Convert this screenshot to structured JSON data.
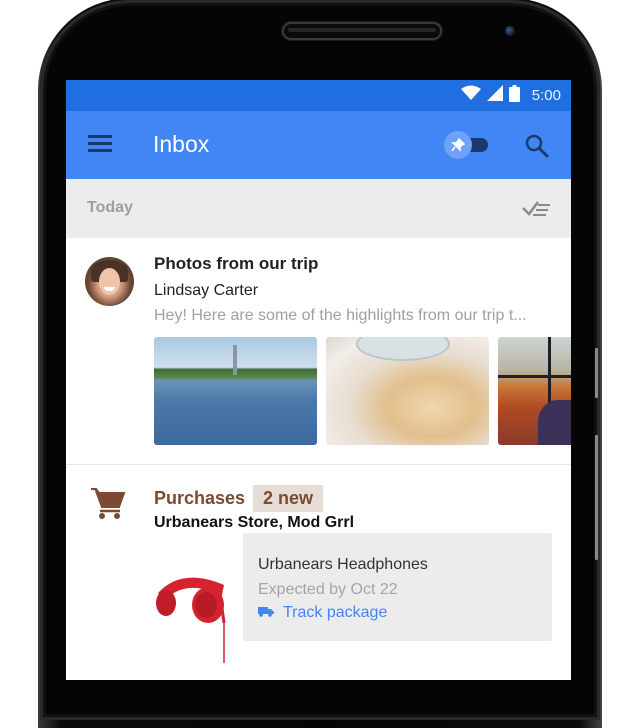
{
  "status_bar": {
    "icons": [
      "wifi-icon",
      "signal-icon",
      "battery-icon"
    ],
    "time": "5:00"
  },
  "app_bar": {
    "menu_icon": "hamburger-menu-icon",
    "title": "Inbox",
    "pin_toggle": {
      "icon": "pin-icon",
      "state": "off"
    },
    "search_icon": "search-icon"
  },
  "colors": {
    "status_bar": "#1f6fe0",
    "app_bar": "#4285f4",
    "purchases_accent": "#7b4a31",
    "link": "#4285f4"
  },
  "sections": {
    "today": {
      "label": "Today",
      "action_icon": "sweep-done-icon"
    }
  },
  "items": {
    "trip": {
      "title": "Photos from our trip",
      "sender": "Lindsay Carter",
      "snippet": "Hey! Here are some of the highlights from our trip t...",
      "photos": [
        "reflecting-pool-photo",
        "pastry-photo",
        "autumn-view-photo"
      ]
    },
    "purchases": {
      "icon": "shopping-cart-icon",
      "title": "Purchases",
      "badge": "2 new",
      "senders": "Urbanears Store, Mod Grrl",
      "package": {
        "image": "red-headphones-image",
        "name": "Urbanears Headphones",
        "eta": "Expected by Oct 22",
        "action_icon": "truck-icon",
        "action_label": "Track package"
      }
    }
  }
}
